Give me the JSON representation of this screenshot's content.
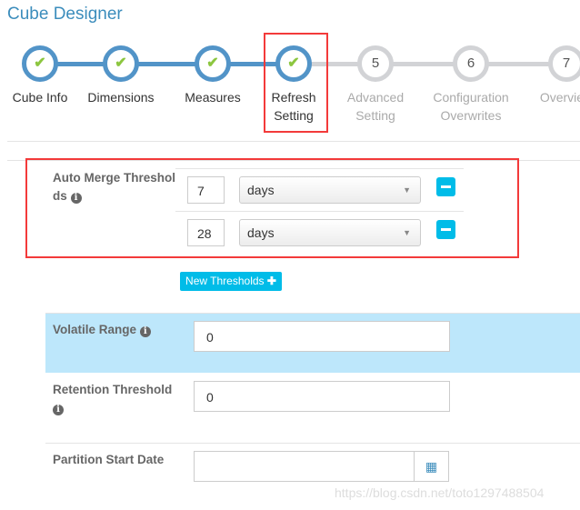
{
  "title": "Cube Designer",
  "steps": [
    {
      "label": "Cube Info",
      "state": "done"
    },
    {
      "label": "Dimensions",
      "state": "done"
    },
    {
      "label": "Measures",
      "state": "done"
    },
    {
      "label": "Refresh Setting",
      "line1": "Refresh",
      "line2": "Setting",
      "state": "done"
    },
    {
      "number": "5",
      "line1": "Advanced",
      "line2": "Setting",
      "state": "todo"
    },
    {
      "number": "6",
      "line1": "Configuration",
      "line2": "Overwrites",
      "state": "todo"
    },
    {
      "number": "7",
      "label": "Overview",
      "state": "todo"
    }
  ],
  "auto_merge": {
    "label_line1": "Auto Merge Threshol",
    "label_line2": "ds",
    "thresholds": [
      {
        "value": "7",
        "unit": "days"
      },
      {
        "value": "28",
        "unit": "days"
      }
    ],
    "new_button": "New Thresholds"
  },
  "volatile": {
    "label": "Volatile Range",
    "value": "0"
  },
  "retention": {
    "label": "Retention Threshold",
    "value": "0"
  },
  "partition": {
    "label": "Partition Start Date",
    "value": ""
  },
  "watermark": "https://blog.csdn.net/toto1297488504",
  "colors": {
    "accent": "#5294c8",
    "done_check": "#8cc63f",
    "button": "#00bce8",
    "highlight_row": "#bde7fb",
    "annotation": "#f33a3a"
  }
}
